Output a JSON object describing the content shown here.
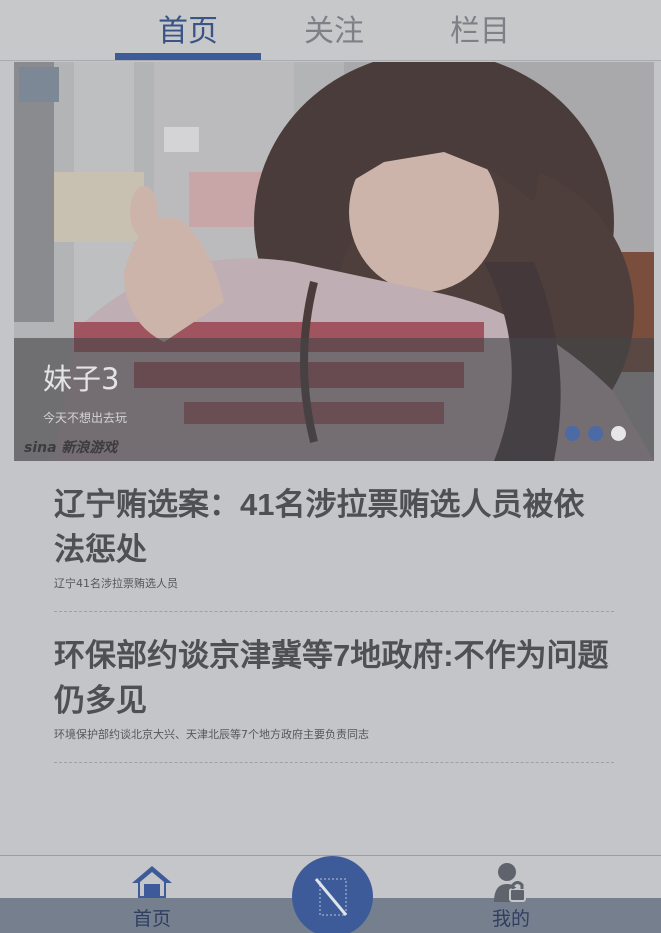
{
  "top_tabs": [
    {
      "label": "首页",
      "active": true
    },
    {
      "label": "关注",
      "active": false
    },
    {
      "label": "栏目",
      "active": false
    }
  ],
  "banner": {
    "title": "妹子3",
    "subtitle": "今天不想出去玩",
    "watermark": "sina 新浪游戏",
    "slide_count": 3,
    "active_slide": 3
  },
  "news": [
    {
      "title": "辽宁贿选案：41名涉拉票贿选人员被依法惩处",
      "summary": "辽宁41名涉拉票贿选人员"
    },
    {
      "title": "环保部约谈京津冀等7地政府:不作为问题仍多见",
      "summary": "环境保护部约谈北京大兴、天津北辰等7个地方政府主要负责同志"
    }
  ],
  "bottom_nav": {
    "home_label": "首页",
    "mine_label": "我的",
    "home_icon": "house-icon",
    "center_icon": "pen-icon",
    "mine_icon": "user-lock-icon"
  },
  "colors": {
    "accent": "#3e5b99",
    "background": "#c3c5c8",
    "news_title": "#4f5053"
  }
}
